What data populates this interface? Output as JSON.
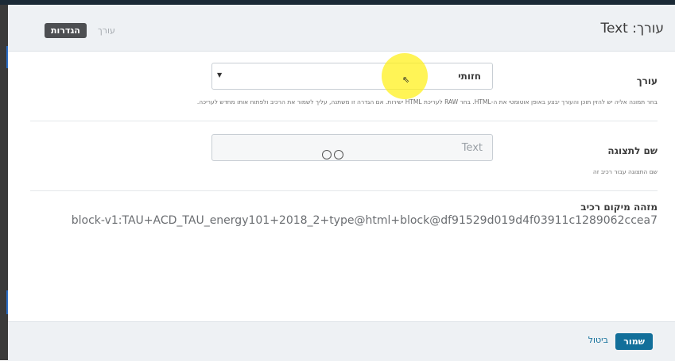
{
  "modal": {
    "title": "עורך: Text",
    "tabs": {
      "editor": "עורך",
      "settings": "הגדרות"
    }
  },
  "fields": {
    "editor": {
      "label": "עורך",
      "value": "חזותי",
      "help": "בחר תמונה אליה יש להזין תוכן והעורך יבצע באופן אוטומטי את ה-HTML. בחר RAW לעריכת HTML ישירות. אם הגדרה זו משתנה, עליך לשמור את הרכיב ולפתוח אותו מחדש לעריכה."
    },
    "display_name": {
      "label": "שם לתצוגה",
      "value": "Text",
      "help": "שם התצוגה עבור רכיב זה"
    },
    "locator": {
      "label": "מזהה מיקום רכיב",
      "value": "block-v1:TAU+ACD_TAU_energy101+2018_2+type@html+block@df91529d019d4f03911c1289062ccea7"
    }
  },
  "footer": {
    "save": "שמור",
    "cancel": "ביטול"
  },
  "colors": {
    "accent": "#126f9a",
    "highlight": "#fff01e"
  }
}
